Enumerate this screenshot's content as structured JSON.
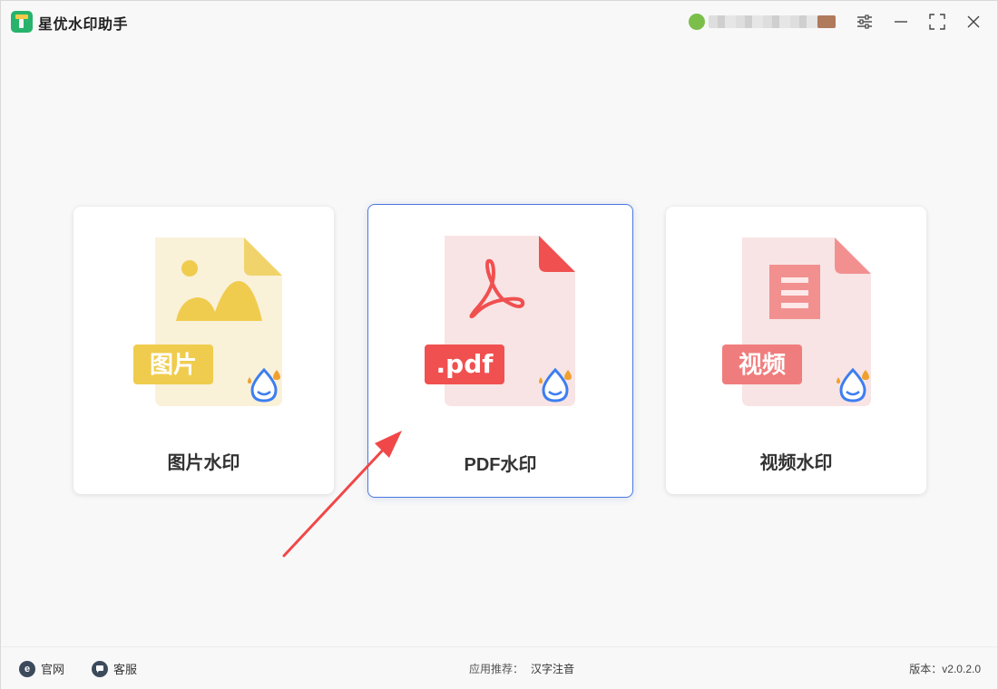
{
  "app": {
    "title": "星优水印助手"
  },
  "cards": [
    {
      "label": "图片水印",
      "badge": "图片"
    },
    {
      "label": "PDF水印",
      "badge": ".pdf"
    },
    {
      "label": "视频水印",
      "badge": "视频"
    }
  ],
  "footer": {
    "website_label": "官网",
    "support_label": "客服",
    "recommend_prefix": "应用推荐：",
    "recommend_app": "汉字注音",
    "version_text": "版本：v2.0.2.0"
  },
  "colors": {
    "image_accent": "#f0cc4e",
    "pdf_accent": "#f05050",
    "video_accent": "#f07d7d",
    "selected_border": "#4a78e0",
    "arrow": "#f04848"
  }
}
